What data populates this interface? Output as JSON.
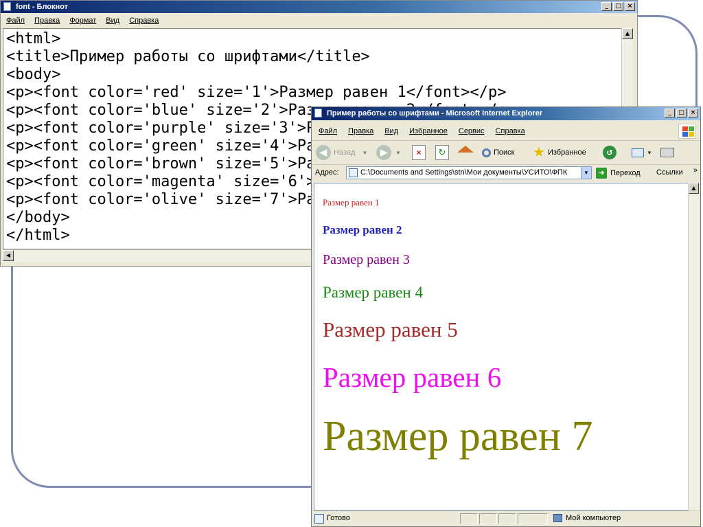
{
  "notepad": {
    "title": "font - Блокнот",
    "menu": [
      "Файл",
      "Правка",
      "Формат",
      "Вид",
      "Справка"
    ],
    "lines": [
      "<html>",
      "<title>Пример работы со шрифтами</title>",
      "<body>",
      "<p><font color='red' size='1'>Размер равен 1</font></p>",
      "<p><font color='blue' size='2'>Размер равен 2</font></p>",
      "<p><font color='purple' size='3'>Размер равен 3</font></p>",
      "<p><font color='green' size='4'>Размер равен 4</font></p>",
      "<p><font color='brown' size='5'>Размер равен 5</font></p>",
      "<p><font color='magenta' size='6'>Размер равен 6</font></p>",
      "<p><font color='olive' size='7'>Размер равен 7</font></p>",
      "</body>",
      "</html>"
    ]
  },
  "ie": {
    "title": "Пример работы со шрифтами - Microsoft Internet Explorer",
    "menu": [
      "Файл",
      "Правка",
      "Вид",
      "Избранное",
      "Сервис",
      "Справка"
    ],
    "toolbar": {
      "back": "Назад",
      "search": "Поиск",
      "favorites": "Избранное"
    },
    "address": {
      "label": "Адрес:",
      "value": "C:\\Documents and Settings\\stn\\Мои документы\\УСИТО\\ФПК",
      "go": "Переход",
      "links": "Ссылки"
    },
    "content": [
      {
        "text": "Размер равен 1",
        "color": "#cc2222"
      },
      {
        "text": "Размер равен 2",
        "color": "#2222bb"
      },
      {
        "text": "Размер равен 3",
        "color": "#800080"
      },
      {
        "text": "Размер равен 4",
        "color": "#138a13"
      },
      {
        "text": "Размер равен 5",
        "color": "#a52a2a"
      },
      {
        "text": "Размер равен 6",
        "color": "#ee10ee"
      },
      {
        "text": "Размер равен 7",
        "color": "#808000"
      }
    ],
    "status": {
      "text": "Готово",
      "zone": "Мой компьютер"
    }
  }
}
